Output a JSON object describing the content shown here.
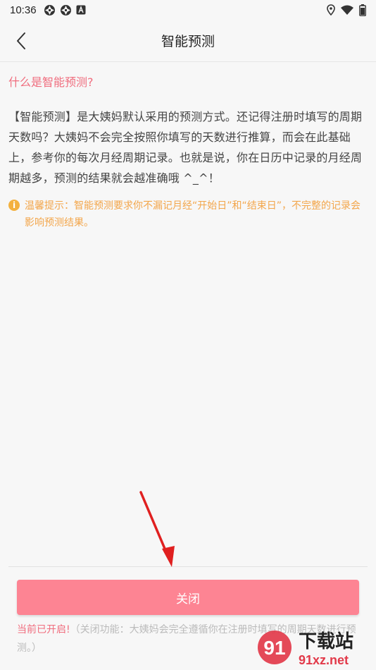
{
  "status_bar": {
    "time": "10:36",
    "left_icons": [
      "aperture-icon",
      "aperture-icon",
      "a-badge-icon"
    ],
    "right_icons": [
      "location-icon",
      "wifi-icon",
      "battery-icon"
    ]
  },
  "header": {
    "title": "智能预测",
    "back_icon": "chevron-left-icon"
  },
  "main": {
    "heading": "什么是智能预测?",
    "description": "【智能预测】是大姨妈默认采用的预测方式。还记得注册时填写的周期天数吗？大姨妈不会完全按照你填写的天数进行推算，而会在此基础上，参考你的每次月经周期记录。也就是说，你在日历中记录的月经周期越多，预测的结果就会越准确哦 ^_^！",
    "tip_icon_glyph": "i",
    "tip": "温馨提示：智能预测要求你不漏记月经“开始日”和“结束日”，不完整的记录会影响预测结果。"
  },
  "footer": {
    "close_label": "关闭",
    "status_on": "当前已开启!",
    "status_desc": "（关闭功能：大姨妈会完全遵循你在注册时填写的周期天数进行预测。）"
  },
  "watermark": {
    "brand": "下载站",
    "domain": "91xz.net"
  },
  "colors": {
    "accent": "#fd8493",
    "heading": "#f06d7e",
    "tip": "#f3a64b",
    "arrow": "#e02020"
  }
}
